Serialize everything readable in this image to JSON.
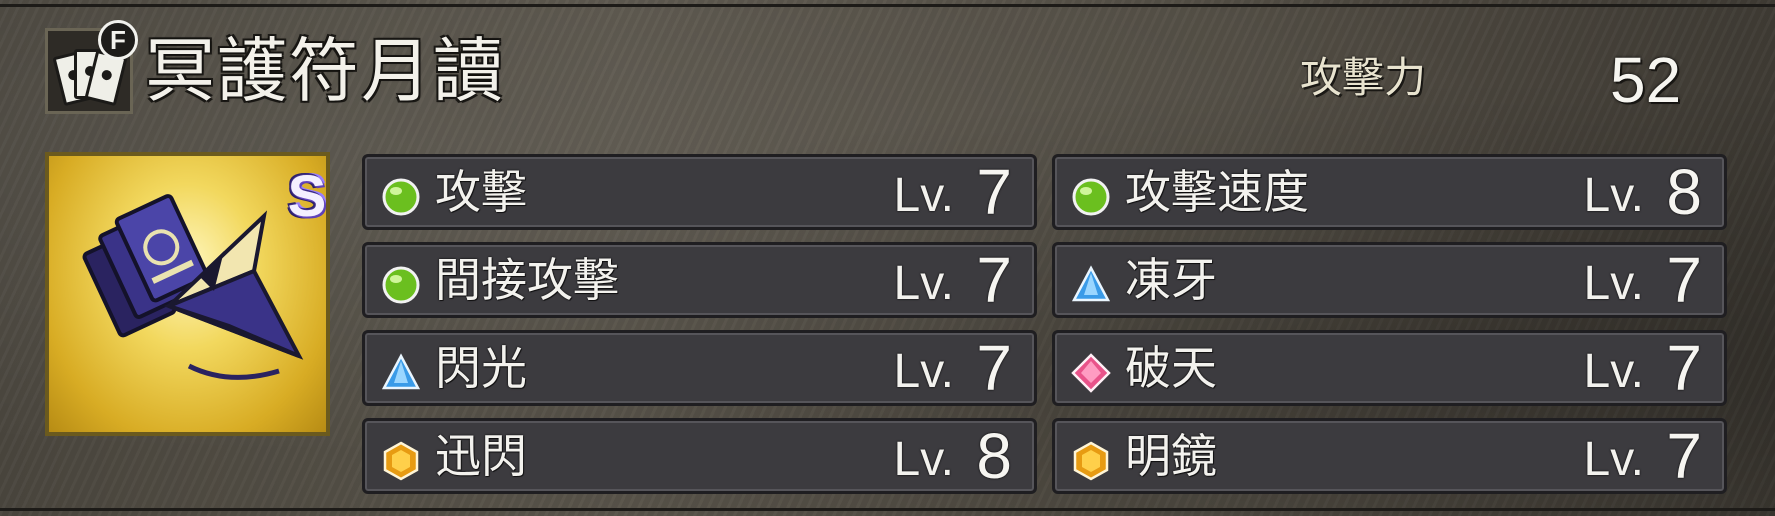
{
  "header": {
    "weapon_type_badge": "F",
    "weapon_name": "冥護符月讀",
    "attack_label": "攻擊力",
    "attack_value": "52"
  },
  "weapon": {
    "rank": "S",
    "image_icon": "paper-crane-talisman-icon",
    "type_icon": "cards-icon"
  },
  "skills": [
    {
      "name": "攻擊",
      "lv_prefix": "Lv.",
      "level": "7",
      "gem": "green-orb-icon"
    },
    {
      "name": "攻擊速度",
      "lv_prefix": "Lv.",
      "level": "8",
      "gem": "green-orb-icon"
    },
    {
      "name": "間接攻擊",
      "lv_prefix": "Lv.",
      "level": "7",
      "gem": "green-orb-icon"
    },
    {
      "name": "凍牙",
      "lv_prefix": "Lv.",
      "level": "7",
      "gem": "blue-triangle-gem-icon"
    },
    {
      "name": "閃光",
      "lv_prefix": "Lv.",
      "level": "7",
      "gem": "blue-triangle-gem-icon"
    },
    {
      "name": "破天",
      "lv_prefix": "Lv.",
      "level": "7",
      "gem": "pink-diamond-gem-icon"
    },
    {
      "name": "迅閃",
      "lv_prefix": "Lv.",
      "level": "8",
      "gem": "gold-hexagon-gem-icon"
    },
    {
      "name": "明鏡",
      "lv_prefix": "Lv.",
      "level": "7",
      "gem": "gold-hexagon-gem-icon"
    }
  ],
  "colors": {
    "background": "#524d44",
    "skill_panel": "#3c3b3f",
    "weapon_frame": "#d8ac24",
    "rank_badge": "#7a5cd6"
  }
}
